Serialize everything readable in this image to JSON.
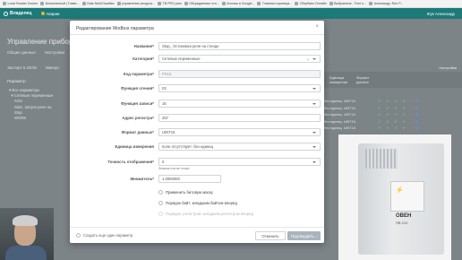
{
  "bookmarks": [
    "Local Reader Docker",
    "Бесконечный | Главн...",
    "Gate Nekt/Ошибки",
    "управление ресурса...",
    "ТВ PRO.plan",
    "Обсуждаемые отп...",
    "Анонсы в Google...",
    "Главная страница...",
    "Сбербанк Онлайн",
    "Выбранные - Free s...",
    "Александр: Ruh P..."
  ],
  "header": {
    "logo": "Владелец",
    "alarms": "Аварии",
    "user": "Жук Александр"
  },
  "background": {
    "title": "Управление прибором: П",
    "tabs": [
      "Общие данные",
      "Настройки"
    ],
    "toolbar": [
      "Экспорт в JSON",
      "Импорт"
    ],
    "param_header": "Параметр",
    "tree": [
      "▾ Все параметры",
      "  ▾ Сетевые переменные",
      "     AOU",
      "     Start. Запуск реле на",
      "     Stop",
      "     WORK"
    ],
    "right_headers": [
      "Единица измерения",
      "Формат данных"
    ],
    "rows": [
      {
        "unit": "без единиц",
        "fmt": "UINT16"
      },
      {
        "unit": "без единиц",
        "fmt": "UINT16"
      },
      {
        "unit": "без единиц",
        "fmt": "UINT16"
      },
      {
        "unit": "без единиц",
        "fmt": "UINT16"
      },
      {
        "unit": "без единиц",
        "fmt": "UINT16"
      }
    ],
    "settings_link": "Настройки"
  },
  "modal": {
    "title": "Редактирование Modbus параметра",
    "close": "×",
    "fields": {
      "name": {
        "label": "Название*",
        "value": "Stop_ Остановка реле на стенде"
      },
      "category": {
        "label": "Категория*",
        "value": "Сетевые переменные"
      },
      "code": {
        "label": "Код параметра*",
        "value": "PS13"
      },
      "read_fn": {
        "label": "Функция чтения*",
        "value": "03"
      },
      "write_fn": {
        "label": "Функция записи*",
        "value": "16"
      },
      "register": {
        "label": "Адрес регистра*",
        "value": "257"
      },
      "format": {
        "label": "Формат данных*",
        "value": "UINT16"
      },
      "unit": {
        "label": "Единица измерения",
        "value": "поле отсутствует: без единиц"
      },
      "precision": {
        "label": "Точность отображения*",
        "value": "0",
        "hint": "Знаков после точки"
      },
      "multiplier": {
        "label": "Множитель*",
        "value": "1.0000000"
      }
    },
    "checks": {
      "bitmask": "Применить битовую маску",
      "byte_order": "Порядок байт: младшим байтом вперёд",
      "word_order": "Порядок: регистров: младшим регистром вперёд"
    },
    "footer": {
      "create_more": "Создать еще один параметр",
      "cancel": "Отменить",
      "submit": "Подтвердить..."
    }
  },
  "device": {
    "brand": "ОВЕН",
    "model": "ПВ 210"
  },
  "colors": {
    "header": "#1c7a78",
    "overlay": "#7c8488",
    "submit_disabled": "#a9b4be"
  }
}
